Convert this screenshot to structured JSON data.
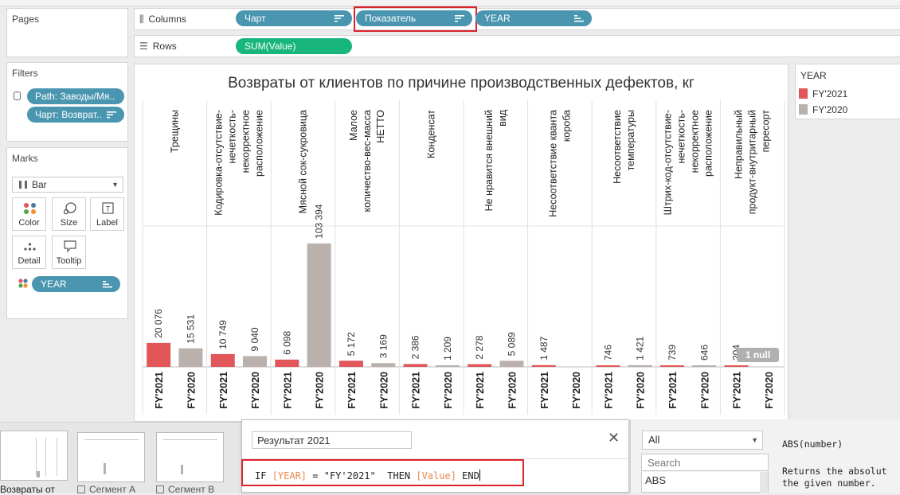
{
  "pages_panel": {
    "title": "Pages"
  },
  "shelves": {
    "columns_label": "Columns",
    "rows_label": "Rows",
    "columns_pills": [
      "Чарт",
      "Показатель",
      "YEAR"
    ],
    "rows_pills": [
      "SUM(Value)"
    ]
  },
  "filters_panel": {
    "title": "Filters",
    "pills": [
      "Path: Заводы/Мя..",
      "Чарт: Возврат.."
    ]
  },
  "marks_panel": {
    "title": "Marks",
    "mark_type": "Bar",
    "cards": [
      "Color",
      "Size",
      "Label",
      "Detail",
      "Tooltip"
    ],
    "color_pill": "YEAR"
  },
  "legend": {
    "title": "YEAR",
    "items": [
      {
        "label": "FY'2021",
        "color": "#e15759"
      },
      {
        "label": "FY'2020",
        "color": "#bab0ac"
      }
    ]
  },
  "chart_data": {
    "type": "bar",
    "title": "Возвраты от клиентов по причине производственных дефектов, кг",
    "categories": [
      "Трещины",
      "Кодировка-отсутствие-нечеткость-некорректное расположение",
      "Мясной сок-сукровица",
      "Малое количество-вес-масса НЕТТО",
      "Конденсат",
      "Не нравится внешний вид",
      "Несоответствие кванта короба",
      "Несоответствие температуры",
      "Штрих-код-отсутствие-нечеткость-некорректное расположение",
      "Неправильный продукт-внутритарный пересорт"
    ],
    "category_lines": [
      [
        "Трещины"
      ],
      [
        "Кодировка-отсутствие-",
        "нечеткость-",
        "некорректное",
        "расположение"
      ],
      [
        "Мясной сок-сукровица"
      ],
      [
        "Малое",
        "количество-вес-масса",
        "НЕТТО"
      ],
      [
        "Конденсат"
      ],
      [
        "Не нравится внешний",
        "вид"
      ],
      [
        "Несоответствие кванта",
        "короба"
      ],
      [
        "Несоответствие",
        "температуры"
      ],
      [
        "Штрих-код-отсутствие-",
        "нечеткость-",
        "некорректное",
        "расположение"
      ],
      [
        "Неправильный",
        "продукт-внутритарный",
        "пересорт"
      ]
    ],
    "series": [
      {
        "name": "FY'2021",
        "color": "#e15759",
        "values": [
          20076,
          10749,
          6098,
          5172,
          2386,
          2278,
          1487,
          746,
          739,
          204
        ],
        "labels": [
          "20 076",
          "10 749",
          "6 098",
          "5 172",
          "2 386",
          "2 278",
          "1 487",
          "746",
          "739",
          "204"
        ]
      },
      {
        "name": "FY'2020",
        "color": "#bab0ac",
        "values": [
          15531,
          9040,
          103394,
          3169,
          1209,
          5089,
          null,
          1421,
          646,
          null
        ],
        "labels": [
          "15 531",
          "9 040",
          "103 394",
          "3 169",
          "1 209",
          "5 089",
          "",
          "1 421",
          "646",
          ""
        ]
      }
    ],
    "ylim": [
      0,
      118000
    ],
    "null_indicator": "1 null"
  },
  "calc_editor": {
    "name": "Результат 2021",
    "formula_parts": [
      {
        "text": "IF ",
        "kind": "kw"
      },
      {
        "text": "[YEAR]",
        "kind": "field"
      },
      {
        "text": " = ",
        "kind": "kw"
      },
      {
        "text": "\"FY'2021\"",
        "kind": "kw"
      },
      {
        "text": "  THEN ",
        "kind": "kw"
      },
      {
        "text": "[Value]",
        "kind": "field"
      },
      {
        "text": " END",
        "kind": "kw"
      }
    ]
  },
  "functions_panel": {
    "category": "All",
    "search_placeholder": "Search",
    "list": [
      "ABS"
    ],
    "signature": "ABS(number)",
    "description_line1": "Returns the absolut",
    "description_line2": "the given number."
  },
  "sheet_tabs": [
    "Возвраты от",
    "Сегмент А",
    "Сегмент В"
  ]
}
